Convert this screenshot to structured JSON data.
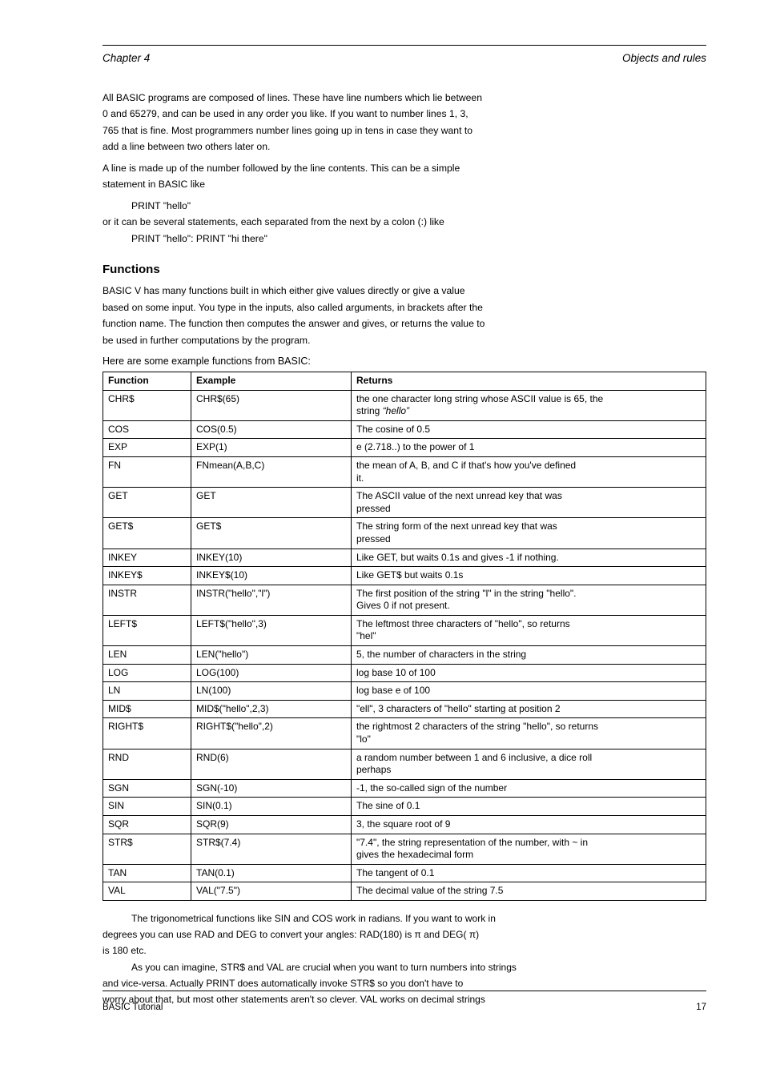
{
  "header": {
    "left": "Chapter 4",
    "right": "Objects and rules"
  },
  "para1_l1": "All BASIC programs are composed of lines.  These have line numbers which lie between",
  "para1_l2": "0 and 65279, and can be used in any order you like.  If you want to number lines 1, 3,",
  "para1_l3": "765 that is fine.  Most programmers number lines going up in tens in case they want to",
  "para1_l4": "add a line between two others later on.",
  "para2_l1": "A line is made up of the number followed by the line contents.  This can be a simple",
  "para2_l2": "statement in BASIC like",
  "code_print": "PRINT \"hello\"",
  "para3_l1": "or it can be several statements, each separated from the next by a colon (:) like",
  "code_print2": ": PRINT \"hi there\"",
  "section_functions": "Functions",
  "func_intro1": "BASIC V has many functions built in which either give values directly or give a value",
  "func_intro2": "based on some input.  You type in the inputs, also called arguments, in brackets after the",
  "func_intro3": "function name.  The function then computes the answer and gives, or returns the value to",
  "func_intro4": "be used in further computations by the program.",
  "table_title": "Here are some example functions from BASIC:",
  "table": {
    "head": [
      "Function",
      "Example",
      "Returns"
    ],
    "rows": [
      [
        "CHR$",
        "CHR$(65)",
        [
          "the one character long string whose ASCII value is 65, the",
          "string ",
          "“hello”"
        ]
      ],
      [
        "COS",
        "COS(0.5)",
        "The cosine of 0.5"
      ],
      [
        "EXP",
        "EXP(1)",
        "e (2.718..) to the power of 1"
      ],
      [
        "FN",
        "FNmean(A,B,C)",
        [
          "the mean of A, B, and C if that's how you've defined",
          "it."
        ]
      ],
      [
        "GET",
        "GET",
        [
          "The ASCII value of the next unread key that was",
          "pressed"
        ]
      ],
      [
        "GET$",
        "GET$",
        [
          "The string form of the next unread key that was",
          "pressed"
        ]
      ],
      [
        "INKEY",
        "INKEY(10)",
        "Like GET, but waits 0.1s and gives -1 if nothing."
      ],
      [
        "INKEY$",
        "INKEY$(10)",
        "Like GET$ but waits 0.1s"
      ],
      [
        "INSTR",
        "INSTR(\"hello\",\"l\")",
        [
          "The first position of the string \"l\" in the string \"hello\".",
          "Gives 0 if not present."
        ]
      ],
      [
        "LEFT$",
        "LEFT$(\"hello\",3)",
        [
          "The leftmost three characters of \"hello\", so returns",
          "\"hel\""
        ]
      ],
      [
        "LEN",
        "LEN(\"hello\")",
        "5, the number of characters in the string"
      ],
      [
        "LOG",
        "LOG(100)",
        "log base 10 of 100"
      ],
      [
        "LN",
        "LN(100)",
        "log base e of 100"
      ],
      [
        "MID$",
        "MID$(\"hello\",2,3)",
        "\"ell\", 3 characters of \"hello\" starting at position 2"
      ],
      [
        "RIGHT$",
        "RIGHT$(\"hello\",2)",
        [
          "the rightmost 2 characters of the string \"hello\", so returns",
          "\"lo\""
        ]
      ],
      [
        "RND",
        "RND(6)",
        [
          "a random number between 1 and 6 inclusive, a dice roll",
          "perhaps"
        ]
      ],
      [
        "SGN",
        "SGN(-10)",
        "-1, the so-called sign of the number"
      ],
      [
        "SIN",
        "SIN(0.1)",
        "The sine of 0.1"
      ],
      [
        "SQR",
        "SQR(9)",
        "3, the square root of 9"
      ],
      [
        "STR$",
        "STR$(7.4)",
        [
          "\"7.4\", the string representation of the number, with ~ in",
          "gives the hexadecimal form"
        ]
      ],
      [
        "TAN",
        "TAN(0.1)",
        "The tangent of 0.1"
      ],
      [
        "VAL",
        "VAL(\"7.5\")",
        "The decimal value of the string 7.5"
      ]
    ]
  },
  "notes": [
    "The trigonometrical functions like SIN and COS work in radians.  If you want to work in",
    "degrees you can use RAD and DEG to convert your angles: RAD(180) is π and DEG( π)",
    "is 180 etc.",
    "As you can imagine, STR$ and VAL are crucial when you want to turn numbers into strings",
    "and vice-versa.  Actually PRINT does automatically invoke STR$ so you don't have to",
    "worry about that, but most other statements aren't so clever.  VAL works on decimal strings"
  ],
  "footer": {
    "left": "BASIC Tutorial",
    "right": "17"
  }
}
